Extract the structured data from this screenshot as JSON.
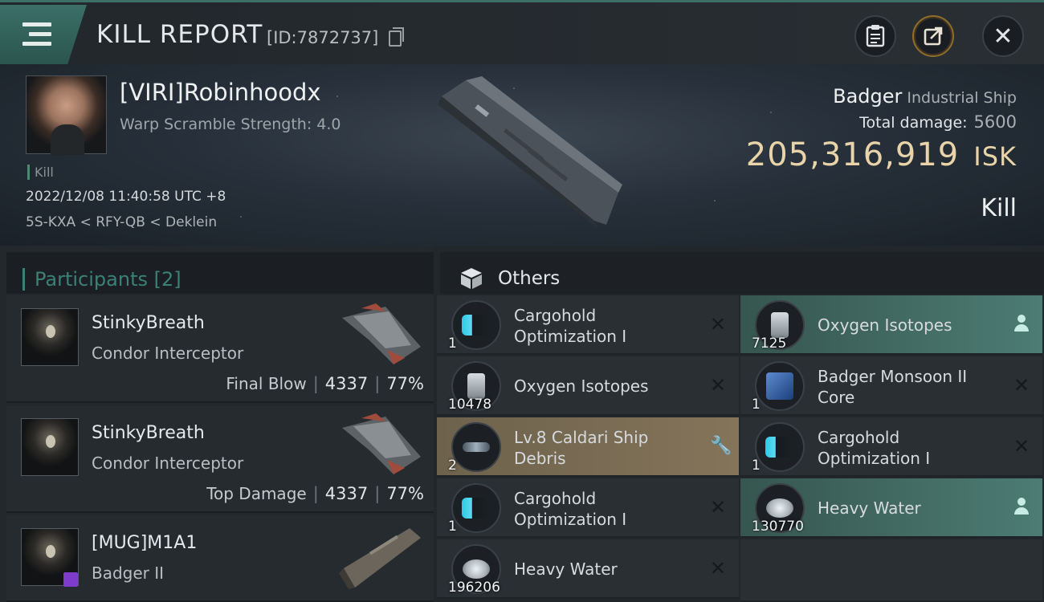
{
  "header": {
    "title": "KILL REPORT",
    "report_id": "[ID:7872737]"
  },
  "victim": {
    "name": "[VIRI]Robinhoodx",
    "warp_scramble": "Warp Scramble Strength: 4.0",
    "kill_tag": "Kill",
    "datetime": "2022/12/08 11:40:58 UTC +8",
    "location": "5S-KXA < RFY-QB < Deklein",
    "ship_name": "Badger",
    "ship_class": "Industrial Ship",
    "total_damage_label": "Total damage:",
    "total_damage_value": "5600",
    "isk_value": "205,316,919",
    "isk_unit": "ISK",
    "result": "Kill"
  },
  "participants": {
    "label": "Participants",
    "count": "[2]",
    "rows": [
      {
        "name": "StinkyBreath",
        "ship": "Condor Interceptor",
        "role": "Final Blow",
        "damage": "4337",
        "percent": "77%"
      },
      {
        "name": "StinkyBreath",
        "ship": "Condor Interceptor",
        "role": "Top Damage",
        "damage": "4337",
        "percent": "77%"
      },
      {
        "name": "[MUG]M1A1",
        "ship": "Badger II"
      }
    ]
  },
  "others": {
    "label": "Others",
    "left_items": [
      {
        "line1": "Cargohold",
        "line2": "Optimization I",
        "qty": "1",
        "icon": "module-icon",
        "action": "close"
      },
      {
        "line1": "Oxygen Isotopes",
        "qty": "10478",
        "icon": "isotope-icon",
        "action": "close"
      },
      {
        "line1": "Lv.8 Caldari Ship",
        "line2": "Debris",
        "qty": "2",
        "icon": "debris-icon",
        "action": "wrench"
      },
      {
        "line1": "Cargohold",
        "line2": "Optimization I",
        "qty": "1",
        "icon": "module-icon",
        "action": "close"
      },
      {
        "line1": "Heavy Water",
        "qty": "196206",
        "icon": "water-icon",
        "action": "close"
      }
    ],
    "right_items": [
      {
        "line1": "Oxygen Isotopes",
        "qty": "7125",
        "icon": "isotope-icon",
        "action": "person"
      },
      {
        "line1": "Badger Monsoon II",
        "line2": "Core",
        "qty": "1",
        "icon": "core-icon",
        "action": "close"
      },
      {
        "line1": "Cargohold",
        "line2": "Optimization I",
        "qty": "1",
        "icon": "module-icon",
        "action": "close"
      },
      {
        "line1": "Heavy Water",
        "qty": "130770",
        "icon": "water-icon",
        "action": "person"
      }
    ]
  },
  "colors": {
    "accent_teal": "#3b8176",
    "isk_gold": "#e8d4a8",
    "highlight_gold": "#84745a",
    "highlight_teal": "#4c7c73"
  }
}
